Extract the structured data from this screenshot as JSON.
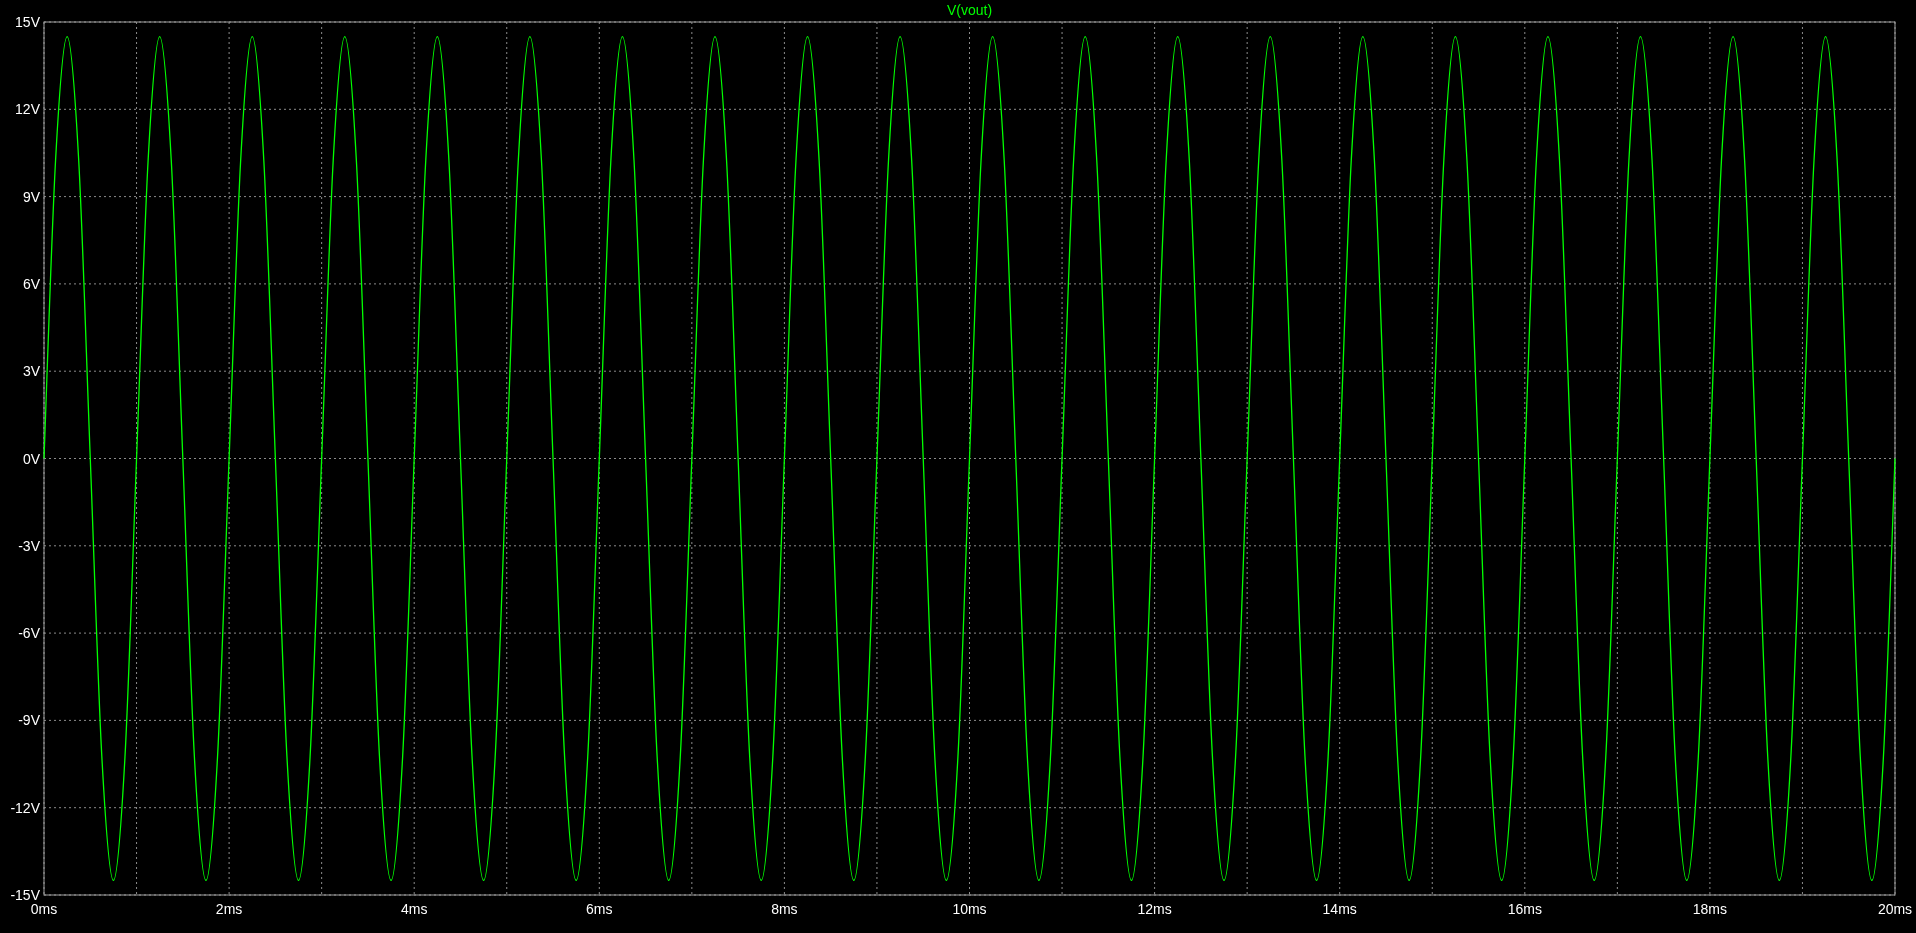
{
  "plot": {
    "chart_data": {
      "type": "line",
      "grid": true,
      "x": [
        0,
        0.125,
        0.25,
        0.375,
        0.5,
        0.625,
        0.75,
        0.875,
        1,
        1.125,
        1.25,
        1.375,
        1.5,
        1.625,
        1.75,
        1.875,
        2,
        2.125,
        2.25,
        2.375,
        2.5,
        2.625,
        2.75,
        2.875,
        3,
        3.125,
        3.25,
        3.375,
        3.5,
        3.625,
        3.75,
        3.875,
        4,
        4.125,
        4.25,
        4.375,
        4.5,
        4.625,
        4.75,
        4.875,
        5,
        5.125,
        5.25,
        5.375,
        5.5,
        5.625,
        5.75,
        5.875,
        6,
        6.125,
        6.25,
        6.375,
        6.5,
        6.625,
        6.75,
        6.875,
        7,
        7.125,
        7.25,
        7.375,
        7.5,
        7.625,
        7.75,
        7.875,
        8,
        8.125,
        8.25,
        8.375,
        8.5,
        8.625,
        8.75,
        8.875,
        9,
        9.125,
        9.25,
        9.375,
        9.5,
        9.625,
        9.75,
        9.875,
        10,
        10.125,
        10.25,
        10.375,
        10.5,
        10.625,
        10.75,
        10.875,
        11,
        11.125,
        11.25,
        11.375,
        11.5,
        11.625,
        11.75,
        11.875,
        12,
        12.125,
        12.25,
        12.375,
        12.5,
        12.625,
        12.75,
        12.875,
        13,
        13.125,
        13.25,
        13.375,
        13.5,
        13.625,
        13.75,
        13.875,
        14,
        14.125,
        14.25,
        14.375,
        14.5,
        14.625,
        14.75,
        14.875,
        15,
        15.125,
        15.25,
        15.375,
        15.5,
        15.625,
        15.75,
        15.875,
        16,
        16.125,
        16.25,
        16.375,
        16.5,
        16.625,
        16.75,
        16.875,
        17,
        17.125,
        17.25,
        17.375,
        17.5,
        17.625,
        17.75,
        17.875,
        18,
        18.125,
        18.25,
        18.375,
        18.5,
        18.625,
        18.75,
        18.875,
        19,
        19.125,
        19.25,
        19.375,
        19.5,
        19.625,
        19.75,
        19.875,
        20
      ],
      "series": [
        {
          "name": "V(vout)",
          "color": "#00ff00",
          "values": [
            0,
            10.25,
            14.5,
            10.25,
            0,
            -10.25,
            -14.5,
            -10.25,
            0,
            10.25,
            14.5,
            10.25,
            0,
            -10.25,
            -14.5,
            -10.25,
            0,
            10.25,
            14.5,
            10.25,
            0,
            -10.25,
            -14.5,
            -10.25,
            0,
            10.25,
            14.5,
            10.25,
            0,
            -10.25,
            -14.5,
            -10.25,
            0,
            10.25,
            14.5,
            10.25,
            0,
            -10.25,
            -14.5,
            -10.25,
            0,
            10.25,
            14.5,
            10.25,
            0,
            -10.25,
            -14.5,
            -10.25,
            0,
            10.25,
            14.5,
            10.25,
            0,
            -10.25,
            -14.5,
            -10.25,
            0,
            10.25,
            14.5,
            10.25,
            0,
            -10.25,
            -14.5,
            -10.25,
            0,
            10.25,
            14.5,
            10.25,
            0,
            -10.25,
            -14.5,
            -10.25,
            0,
            10.25,
            14.5,
            10.25,
            0,
            -10.25,
            -14.5,
            -10.25,
            0,
            10.25,
            14.5,
            10.25,
            0,
            -10.25,
            -14.5,
            -10.25,
            0,
            10.25,
            14.5,
            10.25,
            0,
            -10.25,
            -14.5,
            -10.25,
            0,
            10.25,
            14.5,
            10.25,
            0,
            -10.25,
            -14.5,
            -10.25,
            0,
            10.25,
            14.5,
            10.25,
            0,
            -10.25,
            -14.5,
            -10.25,
            0,
            10.25,
            14.5,
            10.25,
            0,
            -10.25,
            -14.5,
            -10.25,
            0,
            10.25,
            14.5,
            10.25,
            0,
            -10.25,
            -14.5,
            -10.25,
            0,
            10.25,
            14.5,
            10.25,
            0,
            -10.25,
            -14.5,
            -10.25,
            0,
            10.25,
            14.5,
            10.25,
            0,
            -10.25,
            -14.5,
            -10.25,
            0,
            10.25,
            14.5,
            10.25,
            0,
            -10.25,
            -14.5,
            -10.25,
            0,
            10.25,
            14.5,
            10.25,
            0,
            -10.25,
            -14.5,
            -10.25,
            0
          ]
        }
      ],
      "xlim": [
        0,
        20
      ],
      "ylim": [
        -15,
        15
      ],
      "xticks": [
        {
          "value": 0,
          "label": "0ms"
        },
        {
          "value": 2,
          "label": "2ms"
        },
        {
          "value": 4,
          "label": "4ms"
        },
        {
          "value": 6,
          "label": "6ms"
        },
        {
          "value": 8,
          "label": "8ms"
        },
        {
          "value": 10,
          "label": "10ms"
        },
        {
          "value": 12,
          "label": "12ms"
        },
        {
          "value": 14,
          "label": "14ms"
        },
        {
          "value": 16,
          "label": "16ms"
        },
        {
          "value": 18,
          "label": "18ms"
        },
        {
          "value": 20,
          "label": "20ms"
        }
      ],
      "yticks": [
        {
          "value": 15,
          "label": "15V"
        },
        {
          "value": 12,
          "label": "12V"
        },
        {
          "value": 9,
          "label": "9V"
        },
        {
          "value": 6,
          "label": "6V"
        },
        {
          "value": 3,
          "label": "3V"
        },
        {
          "value": 0,
          "label": "0V"
        },
        {
          "value": -3,
          "label": "-3V"
        },
        {
          "value": -6,
          "label": "-6V"
        },
        {
          "value": -9,
          "label": "-9V"
        },
        {
          "value": -12,
          "label": "-12V"
        },
        {
          "value": -15,
          "label": "-15V"
        }
      ]
    }
  }
}
